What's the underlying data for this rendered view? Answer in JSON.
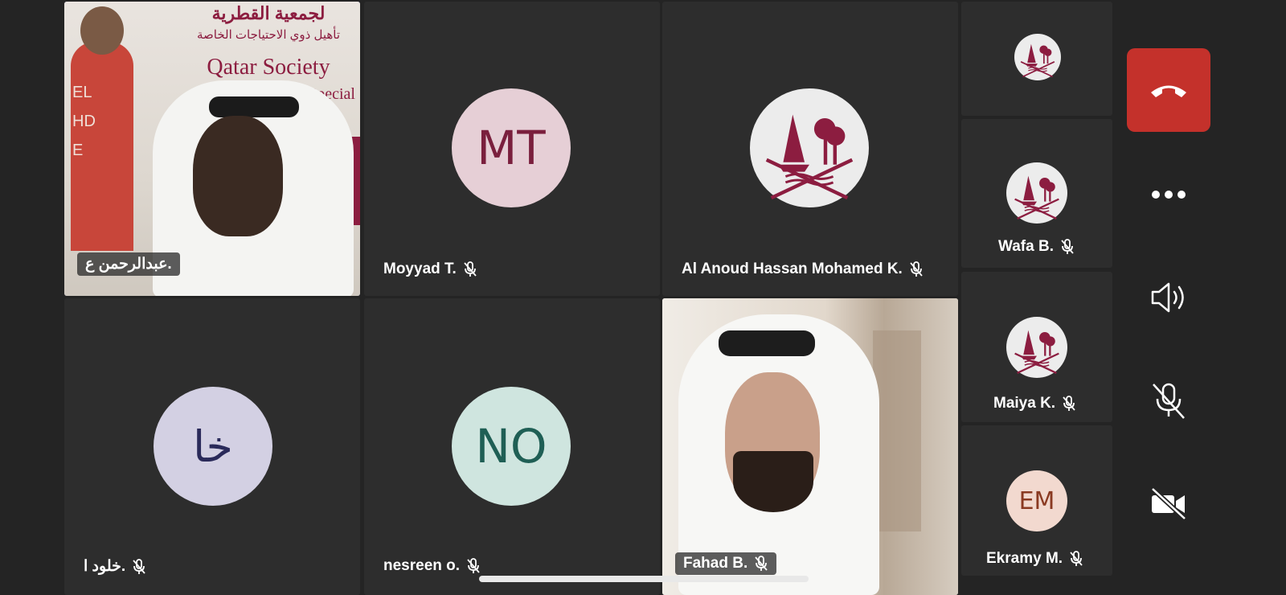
{
  "tiles": {
    "t1": {
      "name": "عبدالرحمن ع.",
      "sign_ar_1": "لجمعية القطرية",
      "sign_ar_2": "تأهيل ذوي الاحتياجات الخاصة",
      "sign_en_1": "Qatar Society",
      "sign_en_2": "Special",
      "shirt_text": "EL HD E"
    },
    "t2": {
      "name": "Moyyad T.",
      "initials": "MT",
      "avatar_bg": "#e6cfd6",
      "avatar_fg": "#7a1f3d"
    },
    "t3": {
      "name": "Al Anoud Hassan Mohamed K."
    },
    "t4": {
      "name": "خلود ا.",
      "initials": "خا",
      "avatar_bg": "#d3d0e3",
      "avatar_fg": "#2a2a5a"
    },
    "t5": {
      "name": "nesreen o.",
      "initials": "NO",
      "avatar_bg": "#cfe5df",
      "avatar_fg": "#1f5f55"
    },
    "t6": {
      "name": "Fahad B."
    }
  },
  "side_tiles": [
    {
      "name": ""
    },
    {
      "name": "Wafa B."
    },
    {
      "name": "Maiya K."
    },
    {
      "name": "Ekramy M.",
      "initials": "EM",
      "avatar_bg": "#f2d9cf",
      "avatar_fg": "#8a3a22"
    }
  ],
  "controls": {
    "end_call_color": "#c4312b",
    "icons": [
      "end-call-icon",
      "more-options-icon",
      "speaker-icon",
      "mic-muted-icon",
      "camera-off-icon"
    ]
  },
  "colors": {
    "active_border": "#6264a7",
    "emblem": "#8c1d40"
  }
}
